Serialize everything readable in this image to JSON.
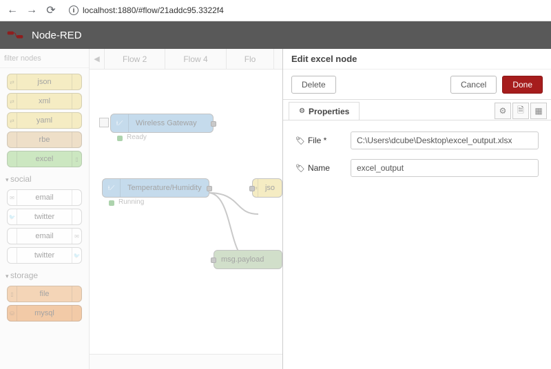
{
  "browser": {
    "url": "localhost:1880/#flow/21addc95.3322f4"
  },
  "header": {
    "title": "Node-RED"
  },
  "palette": {
    "search_placeholder": "filter nodes",
    "items_top": [
      {
        "label": "json",
        "cls": "yellow"
      },
      {
        "label": "xml",
        "cls": "yellow"
      },
      {
        "label": "yaml",
        "cls": "yellow"
      },
      {
        "label": "rbe",
        "cls": "beige"
      },
      {
        "label": "excel",
        "cls": "green"
      }
    ],
    "cat_social": "social",
    "items_social": [
      {
        "label": "email",
        "cls": "white",
        "left": true
      },
      {
        "label": "twitter",
        "cls": "white",
        "left": true
      },
      {
        "label": "email",
        "cls": "white",
        "right": true
      },
      {
        "label": "twitter",
        "cls": "white",
        "right": true
      }
    ],
    "cat_storage": "storage",
    "items_storage": [
      {
        "label": "file",
        "cls": "orange"
      },
      {
        "label": "mysql",
        "cls": "orange2"
      }
    ]
  },
  "tabs": {
    "t1": "Flow 2",
    "t2": "Flow 4",
    "t3": "Flo"
  },
  "flow": {
    "gateway": {
      "label": "Wireless Gateway",
      "status": "Ready"
    },
    "temp": {
      "label": "Temperature/Humidity",
      "status": "Running"
    },
    "json": {
      "label": "jso"
    },
    "debug": {
      "label": "msg.payload"
    }
  },
  "edit": {
    "title": "Edit excel node",
    "delete": "Delete",
    "cancel": "Cancel",
    "done": "Done",
    "properties_tab": "Properties",
    "file_label": "File *",
    "file_value": "C:\\Users\\dcube\\Desktop\\excel_output.xlsx",
    "name_label": "Name",
    "name_value": "excel_output"
  }
}
